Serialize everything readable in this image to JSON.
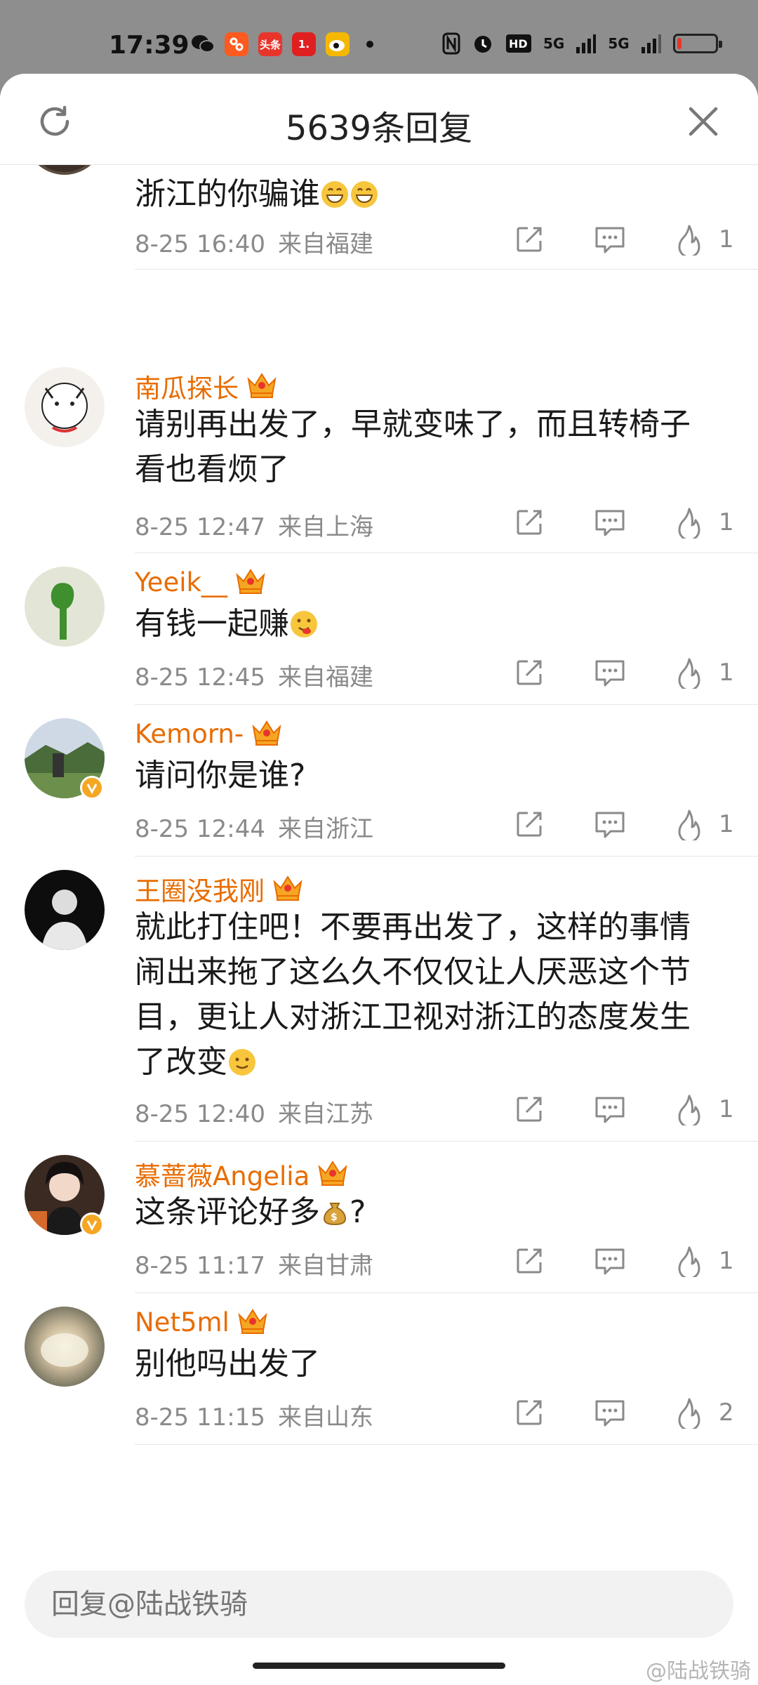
{
  "status_bar": {
    "time": "17:39",
    "apps": [
      {
        "name": "wechat-icon",
        "glyph": "",
        "color": "#111111"
      },
      {
        "name": "taobao-icon",
        "glyph": "",
        "color": "#ff5a1f"
      },
      {
        "name": "toutiao-icon",
        "glyph": "头条",
        "color": "#e8352c"
      },
      {
        "name": "app-1-icon",
        "glyph": "1.",
        "color": "#e02020"
      },
      {
        "name": "weibo-icon",
        "glyph": "",
        "color": "#f5b800"
      }
    ],
    "network_labels": [
      "5G",
      "5G"
    ],
    "battery_level": 0.12
  },
  "header": {
    "title": "5639条回复"
  },
  "comments": [
    {
      "name": "",
      "text": "浙江的你骗谁😁😁",
      "date": "8-25 16:40",
      "location": "来自福建",
      "likes": "1"
    },
    {
      "name": "南瓜探长",
      "text": "请别再出发了，早就变味了，而且转椅子看也看烦了",
      "date": "8-25 12:47",
      "location": "来自上海",
      "likes": "1"
    },
    {
      "name": "Yeeik__",
      "text": "有钱一起赚🤑",
      "date": "8-25 12:45",
      "location": "来自福建",
      "likes": "1"
    },
    {
      "name": "Kemorn-",
      "text": "请问你是谁?",
      "date": "8-25 12:44",
      "location": "来自浙江",
      "likes": "1"
    },
    {
      "name": "王圈没我刚",
      "text": "就此打住吧！不要再出发了，这样的事情闹出来拖了这么久不仅仅让人厌恶这个节目，更让人对浙江卫视对浙江的态度发生了改变🙂",
      "date": "8-25 12:40",
      "location": "来自江苏",
      "likes": "1"
    },
    {
      "name": "慕蔷薇Angelia",
      "text": "这条评论好多💰?",
      "date": "8-25 11:17",
      "location": "来自甘肃",
      "likes": "1"
    },
    {
      "name": "Net5ml",
      "text": "别他吗出发了",
      "date": "8-25 11:15",
      "location": "来自山东",
      "likes": "2"
    }
  ],
  "reply": {
    "placeholder": "回复@陆战铁骑"
  },
  "watermark": "@陆战铁骑"
}
